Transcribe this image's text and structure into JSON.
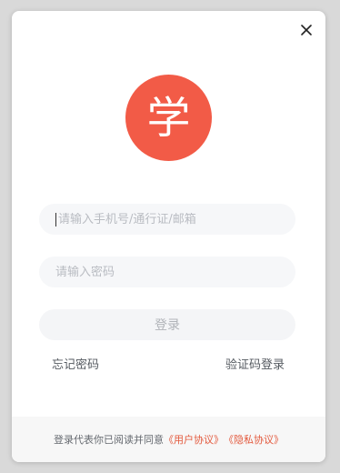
{
  "logo": {
    "char": "学",
    "color": "#f25b47"
  },
  "close": {
    "icon": "close-icon"
  },
  "phone": {
    "placeholder": "请输入手机号/通行证/邮箱",
    "value": ""
  },
  "password": {
    "placeholder": "请输入密码",
    "value": ""
  },
  "login": {
    "label": "登录"
  },
  "links": {
    "forgot": "忘记密码",
    "sms_login": "验证码登录"
  },
  "footer": {
    "prefix": "登录代表你已阅读并同意",
    "user_agreement": "《用户协议》",
    "privacy_agreement": "《隐私协议》",
    "accent": "#e35a3e"
  }
}
